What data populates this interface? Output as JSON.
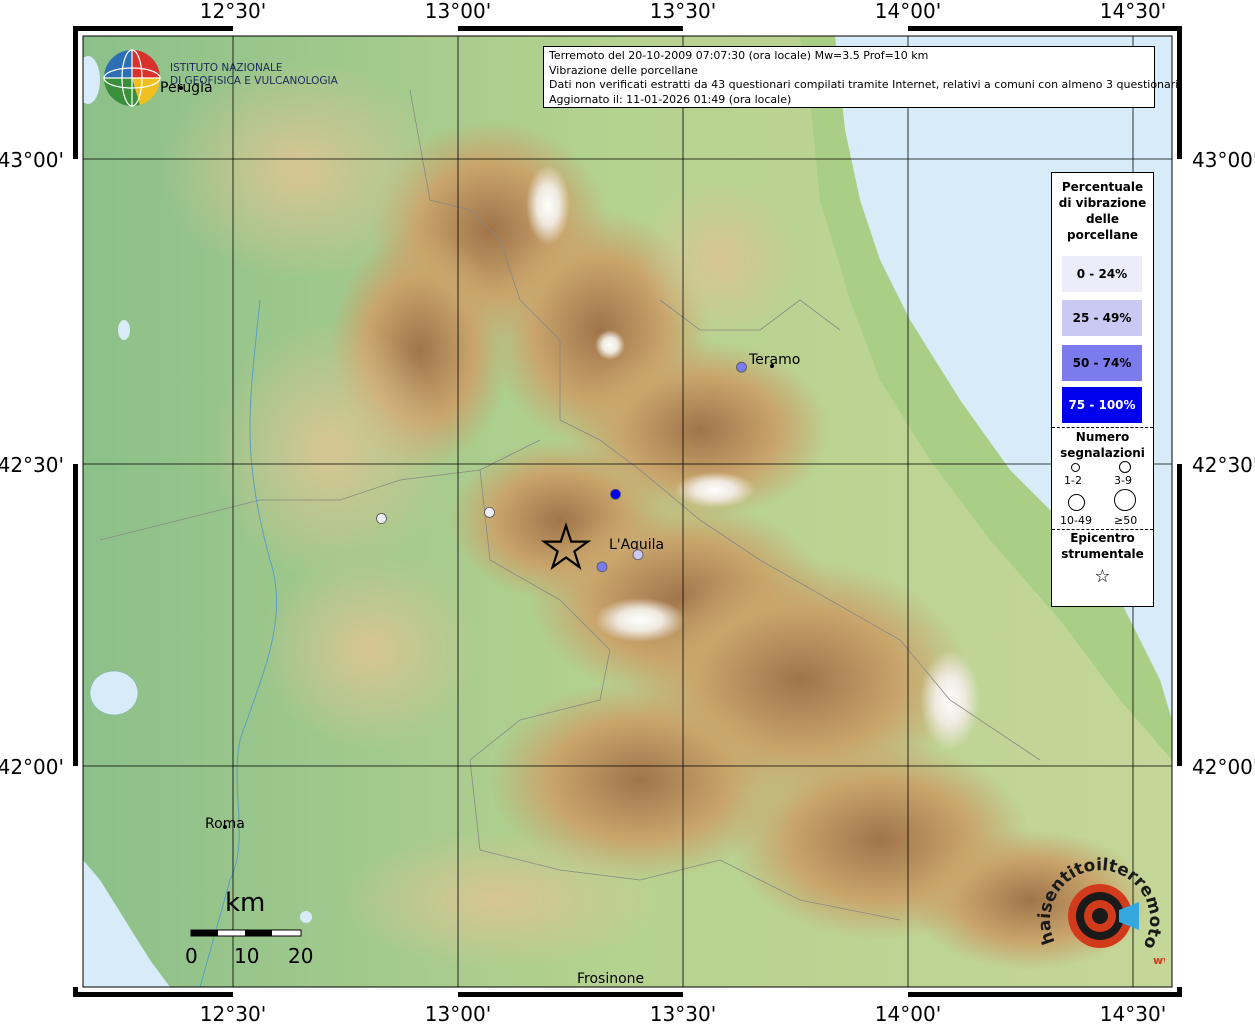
{
  "map": {
    "title_lines": [
      "Terremoto del 20-10-2009 07:07:30 (ora locale) Mw=3.5 Prof=10 km",
      "Vibrazione delle porcellane",
      "Dati non verificati estratti da 43 questionari compilati tramite Internet, relativi a comuni con almeno 3 questionari.",
      "Aggiornato il: 11-01-2026 01:49 (ora locale)"
    ],
    "lon_labels": [
      "12°30'",
      "13°00'",
      "13°30'",
      "14°00'",
      "14°30'"
    ],
    "lat_labels": [
      "43°00'",
      "42°30'",
      "42°00'"
    ],
    "cities": [
      {
        "name": "Perugia"
      },
      {
        "name": "Teramo"
      },
      {
        "name": "L'Aquila"
      },
      {
        "name": "Roma"
      },
      {
        "name": "Frosinone"
      }
    ],
    "observations": [
      {
        "lon": 13.35,
        "lat": 42.45,
        "class": "75 - 100%",
        "color": "#0000ee"
      },
      {
        "lon": 13.32,
        "lat": 42.33,
        "class": "50 - 74%",
        "color": "#7b7bee"
      },
      {
        "lon": 13.4,
        "lat": 42.35,
        "class": "25 - 49%",
        "color": "#c9c9f3"
      },
      {
        "lon": 13.07,
        "lat": 42.42,
        "class": "0 - 24%",
        "color": "#ececfa"
      },
      {
        "lon": 12.83,
        "lat": 42.41,
        "class": "0 - 24%",
        "color": "#ececfa"
      },
      {
        "lon": 13.63,
        "lat": 42.66,
        "class": "50 - 74%",
        "color": "#7b7bee"
      }
    ],
    "epicenter": {
      "lon": 13.24,
      "lat": 42.36
    }
  },
  "institution": {
    "line1": "ISTITUTO NAZIONALE",
    "line2": "DI GEOFISICA E VULCANOLOGIA",
    "overlap_text": "Perugia"
  },
  "legend": {
    "title": [
      "Percentuale",
      "di vibrazione",
      "delle",
      "porcellane"
    ],
    "classes": [
      {
        "label": "0 - 24%",
        "color": "#ececfa",
        "text_color": "#000000"
      },
      {
        "label": "25 - 49%",
        "color": "#c9c9f3",
        "text_color": "#000000"
      },
      {
        "label": "50 - 74%",
        "color": "#7b7bee",
        "text_color": "#000000"
      },
      {
        "label": "75 - 100%",
        "color": "#0000ee",
        "text_color": "#ffffff"
      }
    ],
    "count_title": [
      "Numero",
      "segnalazioni"
    ],
    "counts": [
      "1-2",
      "3-9",
      "10-49",
      "≥50"
    ],
    "epicenter_title": [
      "Epicentro",
      "strumentale"
    ],
    "epicenter_symbol": "☆"
  },
  "scale": {
    "unit": "km",
    "ticks": [
      "0",
      "10",
      "20"
    ]
  },
  "brand": {
    "text": "haisentitoilterremoto.it",
    "prefix": "www."
  }
}
